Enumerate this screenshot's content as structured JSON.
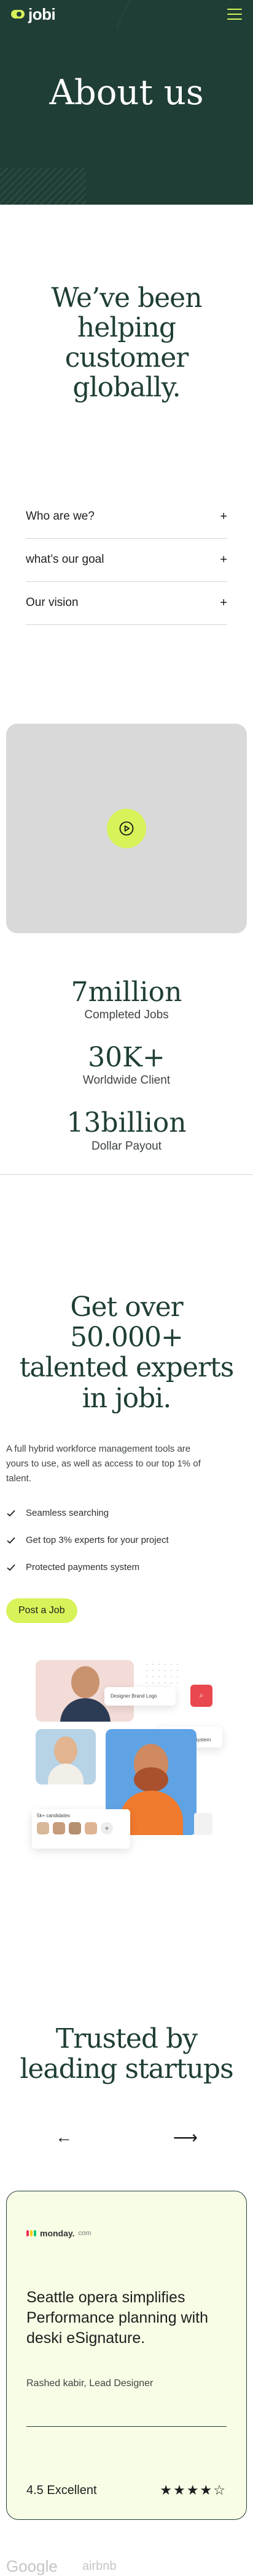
{
  "header": {
    "logo_text": "jobi",
    "menu_icon": "hamburger-menu-icon"
  },
  "hero": {
    "title": "About us"
  },
  "helping": {
    "title": "We’ve been helping customer globally."
  },
  "faq": {
    "items": [
      {
        "label": "Who are we?"
      },
      {
        "label": "what’s our goal"
      },
      {
        "label": "Our vision"
      }
    ],
    "expand_symbol": "+"
  },
  "video": {
    "play_icon": "play-icon"
  },
  "stats": [
    {
      "value": "7million",
      "label": "Completed Jobs"
    },
    {
      "value": "30K+",
      "label": "Worldwide Client"
    },
    {
      "value": "13billion",
      "label": "Dollar Payout"
    }
  ],
  "experts": {
    "title": "Get over 50.000+ talented experts in jobi.",
    "description": "A full hybrid workforce management tools are yours to use, as well as access to our top 1% of talent.",
    "checks": [
      "Seamless searching",
      "Get top 3% experts for your project",
      "Protected payments system"
    ],
    "cta": "Post a Job",
    "collage": {
      "design_card": "Designer Brand Logo",
      "tag_card_line1": "Market",
      "tag_card_line2": "Escrow System",
      "candidates_label": "5k+ candidates"
    }
  },
  "trusted": {
    "title": "Trusted by leading startups",
    "prev": "←",
    "next": "⟶",
    "testimonial": {
      "brand": "monday.",
      "brand_suffix": "com",
      "quote": "Seattle opera simplifies Performance planning with deski eSignature.",
      "author": "Rashed kabir, Lead Designer",
      "rating": "4.5 Excellent",
      "stars": "★★★★☆"
    },
    "logos": [
      "Google",
      "airbnb"
    ]
  },
  "colors": {
    "hero_bg": "#1f3e36",
    "accent": "#d7f35a",
    "card_bg": "#f8fde6"
  }
}
